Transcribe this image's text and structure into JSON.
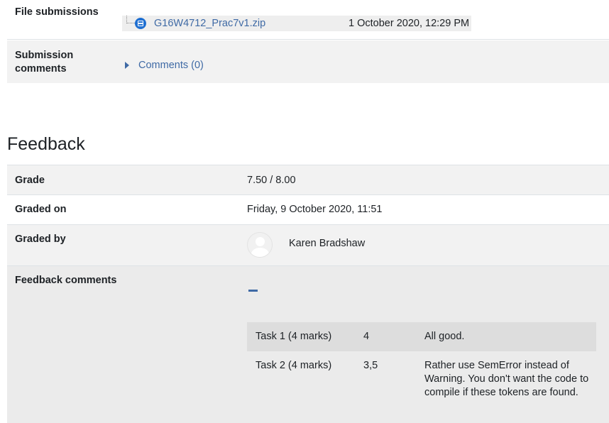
{
  "submission": {
    "file_submissions_label": "File submissions",
    "file": {
      "name": "G16W4712_Prac7v1.zip",
      "date": "1 October 2020, 12:29 PM",
      "icon": "archive-file-icon"
    },
    "comments_label": "Submission comments",
    "comments_link": "Comments (0)"
  },
  "feedback": {
    "heading": "Feedback",
    "grade_label": "Grade",
    "grade_value": "7.50 / 8.00",
    "graded_on_label": "Graded on",
    "graded_on_value": "Friday, 9 October 2020, 11:51",
    "graded_by_label": "Graded by",
    "graded_by_name": "Karen Bradshaw",
    "comments_label": "Feedback comments",
    "table": [
      {
        "task": "Task 1 (4 marks)",
        "mark": "4",
        "comment": "All good."
      },
      {
        "task": "Task 2 (4 marks)",
        "mark": "3,5",
        "comment": "Rather use SemError instead of Warning. You don't want the code to compile if these tokens are found."
      }
    ]
  },
  "colors": {
    "link": "#3f6aa5",
    "file_icon": "#1f6fd1",
    "row_shade": "#f2f2f2"
  }
}
